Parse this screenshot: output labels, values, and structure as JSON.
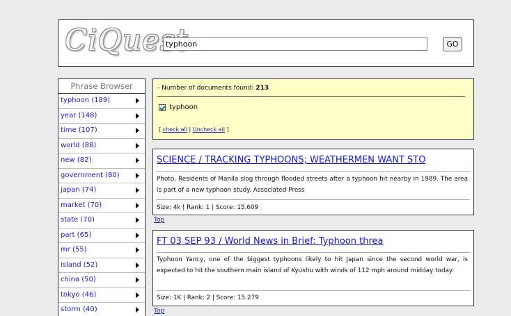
{
  "header": {
    "logo_text": "CiQuest",
    "search_value": "typhoon",
    "go_label": "GO"
  },
  "phrase_browser": {
    "title": "Phrase Browser",
    "items": [
      "typhoon (189)",
      "year (148)",
      "time (107)",
      "world (88)",
      "new (82)",
      "government (80)",
      "japan (74)",
      "market (70)",
      "state (70)",
      "part (65)",
      "mr (55)",
      "island (52)",
      "china (50)",
      "tokyo (46)",
      "storm (40)"
    ]
  },
  "summary": {
    "count_label": "- Number of documents found:",
    "count_value": "213",
    "term": "typhoon",
    "bracket_open": "[",
    "check_all": "check all",
    "separator": "|",
    "uncheck_all": "Uncheck all",
    "bracket_close": "]"
  },
  "results": [
    {
      "title": "SCIENCE / TRACKING TYPHOONS; WEATHERMEN WANT STO",
      "snippet": "Photo, Residents of Manila slog through flooded streets after a typhoon hit nearby in 1989. The area is part of a new typhoon study. Associated Press",
      "meta": "Size: 4k | Rank: 1 | Score: 15.609"
    },
    {
      "title": "FT 03 SEP 93 / World News in Brief: Typhoon threa",
      "snippet": "Typhoon Yancy, one of the biggest typhoons likely to hit Japan since the second world war, is expected to hit the southern main island of Kyushu with winds of 112 mph around midday today.",
      "meta": "Size: 1K | Rank: 2 | Score: 15.279"
    }
  ],
  "top_label": "Top"
}
